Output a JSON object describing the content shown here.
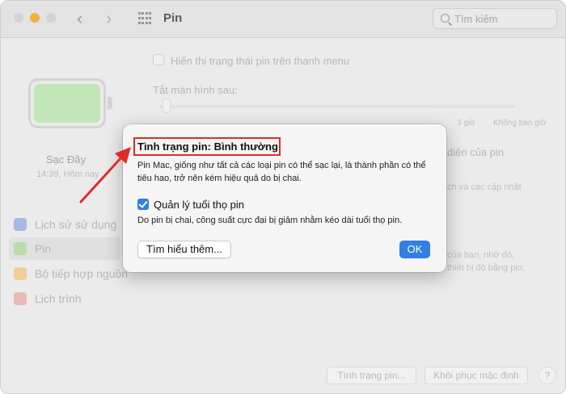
{
  "window": {
    "title": "Pin"
  },
  "toolbar": {
    "back_icon": "chevron-left-icon",
    "forward_icon": "chevron-right-icon",
    "grid_icon": "show-all-grid-icon",
    "search_placeholder": "Tìm kiếm"
  },
  "sidebar": {
    "battery_state": "Sạc Đầy",
    "battery_time": "14:39, Hôm nay",
    "items": [
      {
        "label": "Lịch sử sử dụng",
        "icon": "usage-history-icon"
      },
      {
        "label": "Pin",
        "icon": "battery-icon"
      },
      {
        "label": "Bộ tiếp hợp nguồn",
        "icon": "power-adapter-icon"
      },
      {
        "label": "Lịch trình",
        "icon": "calendar-icon"
      }
    ]
  },
  "main": {
    "show_status_label": "Hiển thị trạng thái pin trên thanh menu",
    "turn_off_label": "Tắt màn hình sau:",
    "slider_ticks": [
      "3 giờ",
      "Không bao giờ"
    ],
    "right_label": "diện của pin",
    "right_sub": "ch và các cập nhật",
    "right_sub2": "của bạn, nhờ đó,",
    "right_sub3": "thiết bị đó bằng pin.",
    "health_button": "Tình trạng pin...",
    "restore_button": "Khôi phục mặc định",
    "help_button": "?"
  },
  "dialog": {
    "title": "Tình trạng pin: Bình thường",
    "description": "Pin Mac, giống như tất cả các loại pin có thể sạc lại, là thành phần có thể tiêu hao, trở nên kém hiệu quả do bị chai.",
    "checkbox_label": "Quản lý tuổi thọ pin",
    "checkbox_checked": true,
    "checkbox_description": "Do pin bị chai, công suất cực đại bị giảm nhằm kéo dài tuổi thọ pin.",
    "learn_more_button": "Tìm hiểu thêm...",
    "ok_button": "OK"
  },
  "colors": {
    "accent": "#2f7fe4",
    "annotation": "#e02b2b",
    "battery_fill": "#aee39e"
  }
}
